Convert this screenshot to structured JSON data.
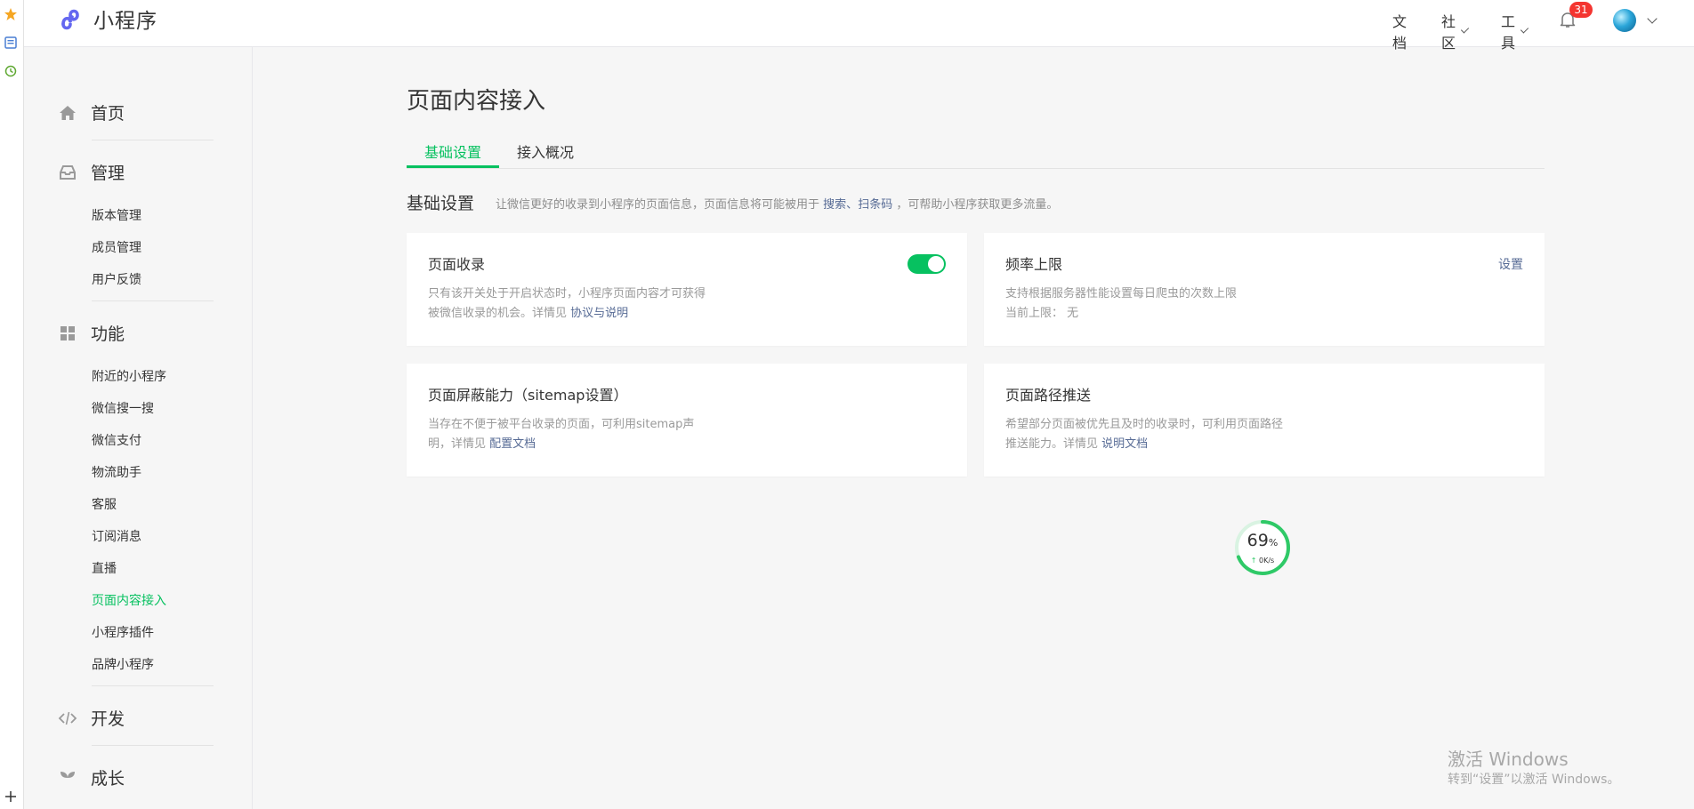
{
  "browser_strip": {
    "icons": [
      "star-icon",
      "reading-list-icon",
      "history-icon",
      "add-icon"
    ],
    "colors": {
      "star": "#f5a623",
      "reading": "#4a7fd4",
      "history": "#5fa832"
    }
  },
  "header": {
    "app_title": "小程序",
    "nav": {
      "docs": "文档",
      "community": "社区",
      "tools": "工具",
      "notification_count": "31"
    }
  },
  "sidebar": {
    "groups": [
      {
        "icon": "home-icon",
        "label": "首页"
      },
      {
        "icon": "inbox-icon",
        "label": "管理"
      },
      {
        "icon": "grid-icon",
        "label": "功能"
      },
      {
        "icon": "code-icon",
        "label": "开发"
      },
      {
        "icon": "sprout-icon",
        "label": "成长"
      }
    ],
    "manage_items": [
      "版本管理",
      "成员管理",
      "用户反馈"
    ],
    "feature_items": [
      "附近的小程序",
      "微信搜一搜",
      "微信支付",
      "物流助手",
      "客服",
      "订阅消息",
      "直播",
      "页面内容接入",
      "小程序插件",
      "品牌小程序"
    ],
    "active_item": "页面内容接入"
  },
  "main": {
    "title": "页面内容接入",
    "tabs": [
      "基础设置",
      "接入概况"
    ],
    "active_tab": "基础设置",
    "section": {
      "title": "基础设置",
      "desc_prefix": "让微信更好的收录到小程序的页面信息，页面信息将可能被用于",
      "link_search": "搜索",
      "separator": "、",
      "link_scan": "扫条码",
      "desc_suffix": "，可帮助小程序获取更多流量。"
    },
    "cards": {
      "page_index": {
        "title": "页面收录",
        "line1": "只有该开关处于开启状态时，小程序页面内容才可获得",
        "line2_prefix": "被微信收录的机会。详情见",
        "line2_link": "协议与说明",
        "toggle_on": true
      },
      "rate_limit": {
        "title": "频率上限",
        "action": "设置",
        "line1": "支持根据服务器性能设置每日爬虫的次数上限",
        "line2": "当前上限： 无"
      },
      "sitemap": {
        "title": "页面屏蔽能力（sitemap设置）",
        "line1": "当存在不便于被平台收录的页面，可利用sitemap声",
        "line2_prefix": "明，详情见",
        "line2_link": "配置文档"
      },
      "path_push": {
        "title": "页面路径推送",
        "line1": "希望部分页面被优先且及时的收录时，可利用页面路径",
        "line2_prefix": "推送能力。详情见",
        "line2_link": "说明文档"
      }
    }
  },
  "speed_widget": {
    "percent": "69",
    "percent_sign": "%",
    "rate": "0K/s",
    "progress": 0.69
  },
  "watermark": {
    "line1": "激活 Windows",
    "line2": "转到“设置”以激活 Windows。"
  },
  "colors": {
    "accent": "#07c160",
    "link": "#576b95",
    "badge": "#f43530"
  }
}
